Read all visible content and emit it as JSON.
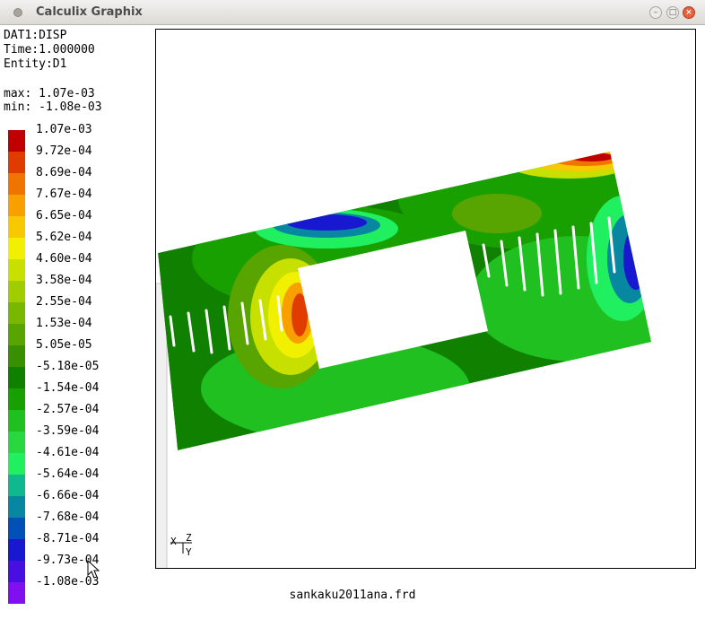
{
  "window": {
    "title": "Calculix Graphix"
  },
  "info": {
    "dataset": "DAT1:DISP",
    "time": "Time:1.000000",
    "entity": "Entity:D1",
    "max": "max: 1.07e-03",
    "min": "min: -1.08e-03"
  },
  "legend": [
    {
      "label": "1.07e-03",
      "color": "#c00000"
    },
    {
      "label": "9.72e-04",
      "color": "#e03c00"
    },
    {
      "label": "8.69e-04",
      "color": "#f07400"
    },
    {
      "label": "7.67e-04",
      "color": "#f8a000"
    },
    {
      "label": "6.65e-04",
      "color": "#f8c800"
    },
    {
      "label": "5.62e-04",
      "color": "#f0f000"
    },
    {
      "label": "4.60e-04",
      "color": "#c8e000"
    },
    {
      "label": "3.58e-04",
      "color": "#a0cc00"
    },
    {
      "label": "2.55e-04",
      "color": "#78b800"
    },
    {
      "label": "1.53e-04",
      "color": "#58a400"
    },
    {
      "label": "5.05e-05",
      "color": "#389000"
    },
    {
      "label": "-5.18e-05",
      "color": "#108000"
    },
    {
      "label": "-1.54e-04",
      "color": "#18a000"
    },
    {
      "label": "-2.57e-04",
      "color": "#20c020"
    },
    {
      "label": "-3.59e-04",
      "color": "#28d840"
    },
    {
      "label": "-4.61e-04",
      "color": "#20f060"
    },
    {
      "label": "-5.64e-04",
      "color": "#10b890"
    },
    {
      "label": "-6.66e-04",
      "color": "#0888a0"
    },
    {
      "label": "-7.68e-04",
      "color": "#0050b8"
    },
    {
      "label": "-8.71e-04",
      "color": "#1818d0"
    },
    {
      "label": "-9.73e-04",
      "color": "#4810e0"
    },
    {
      "label": "-1.08e-03",
      "color": "#8010f0"
    }
  ],
  "axes": {
    "x": "X",
    "z": "Z",
    "y": "Y"
  },
  "footer": {
    "filename": "sankaku2011ana.frd"
  }
}
